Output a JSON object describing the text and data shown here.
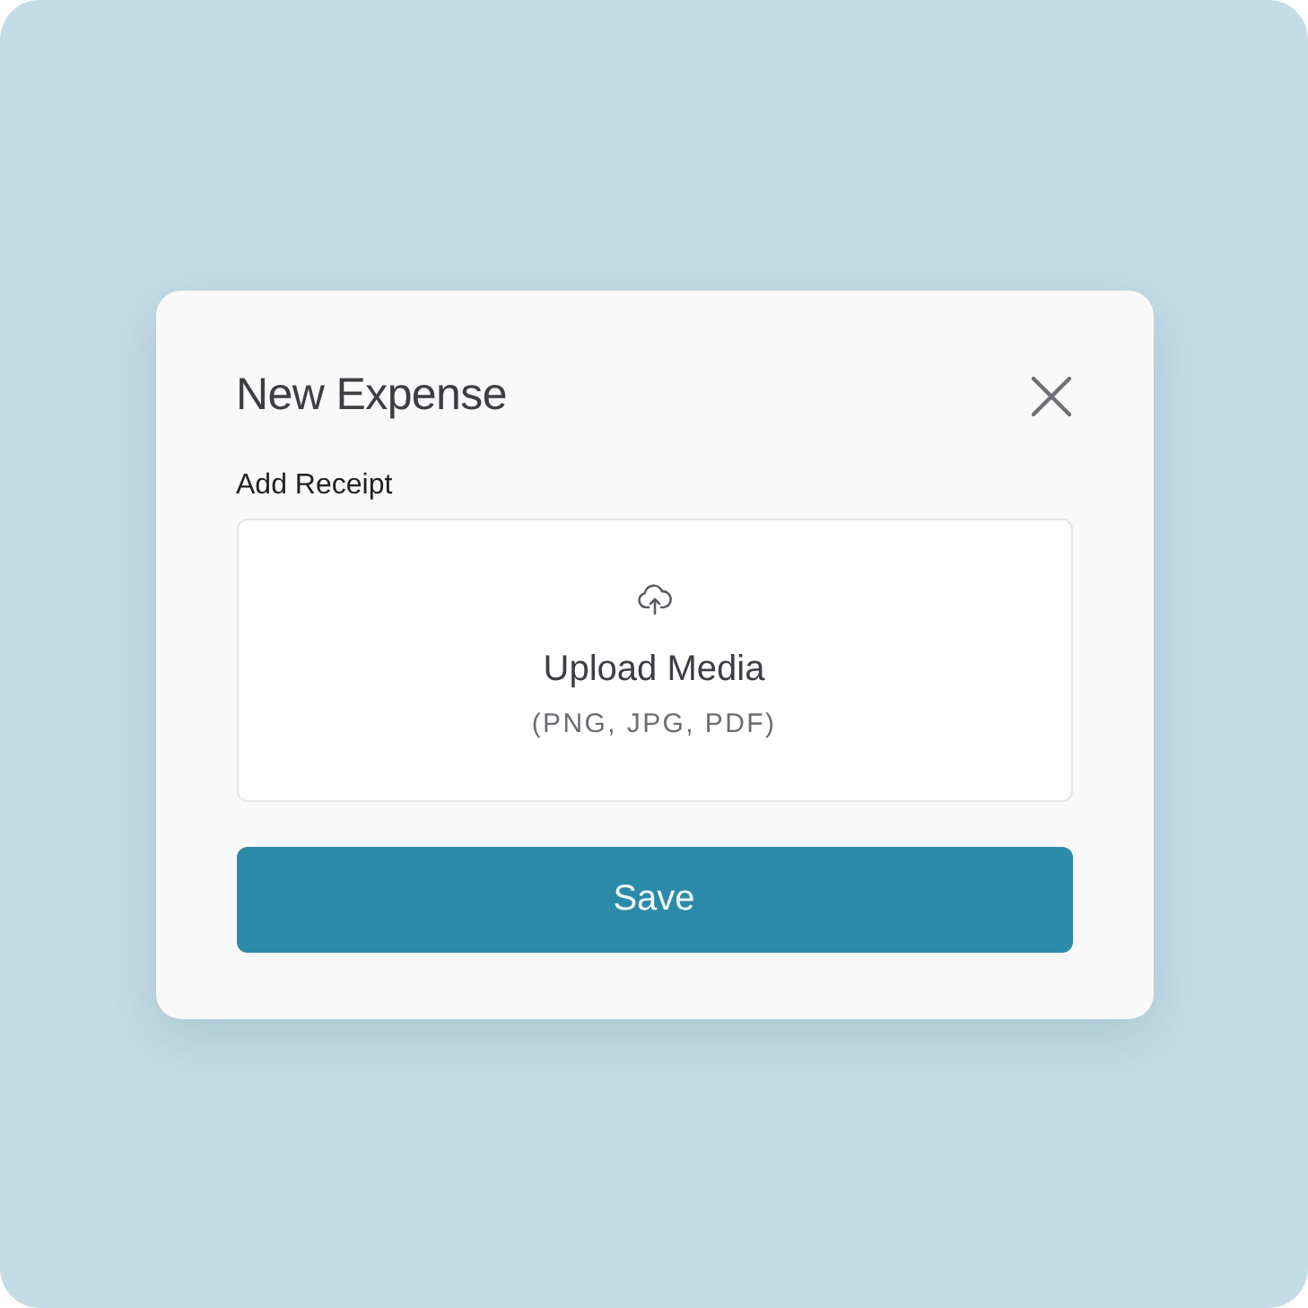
{
  "dialog": {
    "title": "New Expense",
    "field_label": "Add Receipt",
    "upload": {
      "title": "Upload Media",
      "hint": "(PNG, JPG, PDF)"
    },
    "buttons": [
      "Save"
    ]
  }
}
